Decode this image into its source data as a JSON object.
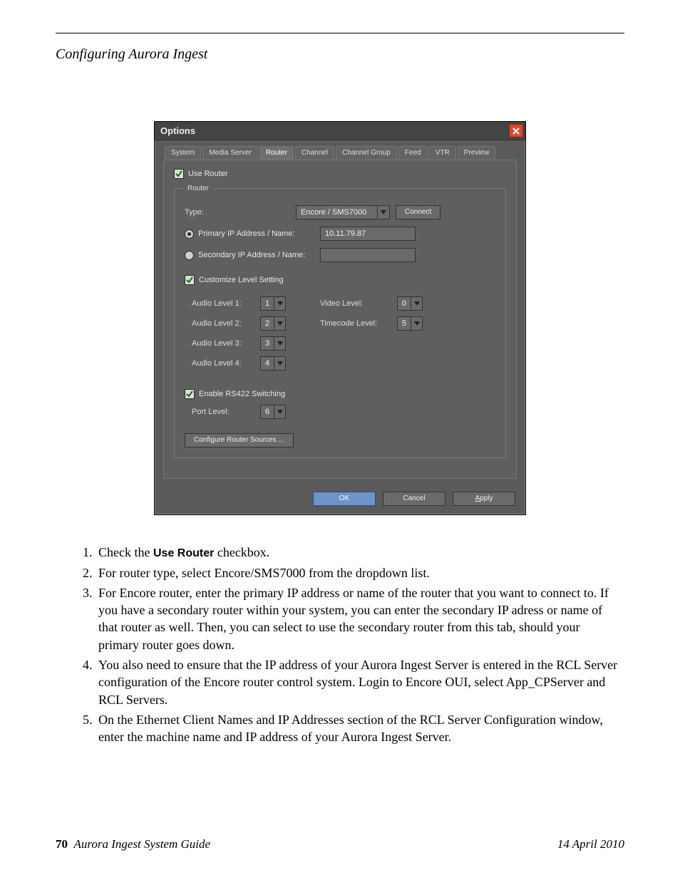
{
  "header": {
    "section_title": "Configuring Aurora Ingest"
  },
  "dialog": {
    "title": "Options",
    "tabs": [
      "System",
      "Media Server",
      "Router",
      "Channel",
      "Channel Group",
      "Feed",
      "VTR",
      "Preview"
    ],
    "active_tab_index": 2,
    "use_router_label": "Use Router",
    "use_router_checked": true,
    "router_legend": "Router",
    "type_label": "Type:",
    "type_value": "Encore / SMS7000",
    "connect_label": "Connect",
    "primary_label": "Primary IP Address / Name:",
    "primary_selected": true,
    "primary_value": "10.11.79.87",
    "secondary_label": "Secondary IP Address / Name:",
    "secondary_selected": false,
    "secondary_value": "",
    "customize_label": "Customize Level Setting",
    "customize_checked": true,
    "audio_levels": [
      {
        "label": "Audio Level 1:",
        "value": "1"
      },
      {
        "label": "Audio Level 2:",
        "value": "2"
      },
      {
        "label": "Audio Level 3:",
        "value": "3"
      },
      {
        "label": "Audio Level 4:",
        "value": "4"
      }
    ],
    "video_level_label": "Video Level:",
    "video_level_value": "0",
    "timecode_level_label": "Timecode Level:",
    "timecode_level_value": "5",
    "enable_rs422_label": "Enable RS422 Switching",
    "enable_rs422_checked": true,
    "port_level_label": "Port Level:",
    "port_level_value": "6",
    "configure_sources_label": "Configure Router Sources ...",
    "ok_label": "OK",
    "cancel_label": "Cancel",
    "apply_prefix": "A",
    "apply_rest": "pply"
  },
  "steps": {
    "s1_a": "Check the ",
    "s1_b": "Use Router",
    "s1_c": " checkbox.",
    "s2": "For router type, select Encore/SMS7000 from the dropdown list.",
    "s3": "For Encore router, enter the primary IP address or name of the router that you want to connect to. If you have a secondary router within your system, you can enter the secondary IP adress or name of that router as well. Then, you can select to use the secondary router from this tab, should your primary router goes down.",
    "s4": "You also need to ensure that the IP address of your Aurora Ingest Server is entered in the RCL Server configuration of the Encore router control system. Login to Encore OUI, select App_CPServer and RCL Servers.",
    "s5": "On the Ethernet Client Names and IP Addresses section of the RCL Server Configuration window, enter the machine name and IP address of your Aurora Ingest Server."
  },
  "footer": {
    "page_number": "70",
    "guide_title": "Aurora Ingest System Guide",
    "date": "14 April 2010"
  }
}
